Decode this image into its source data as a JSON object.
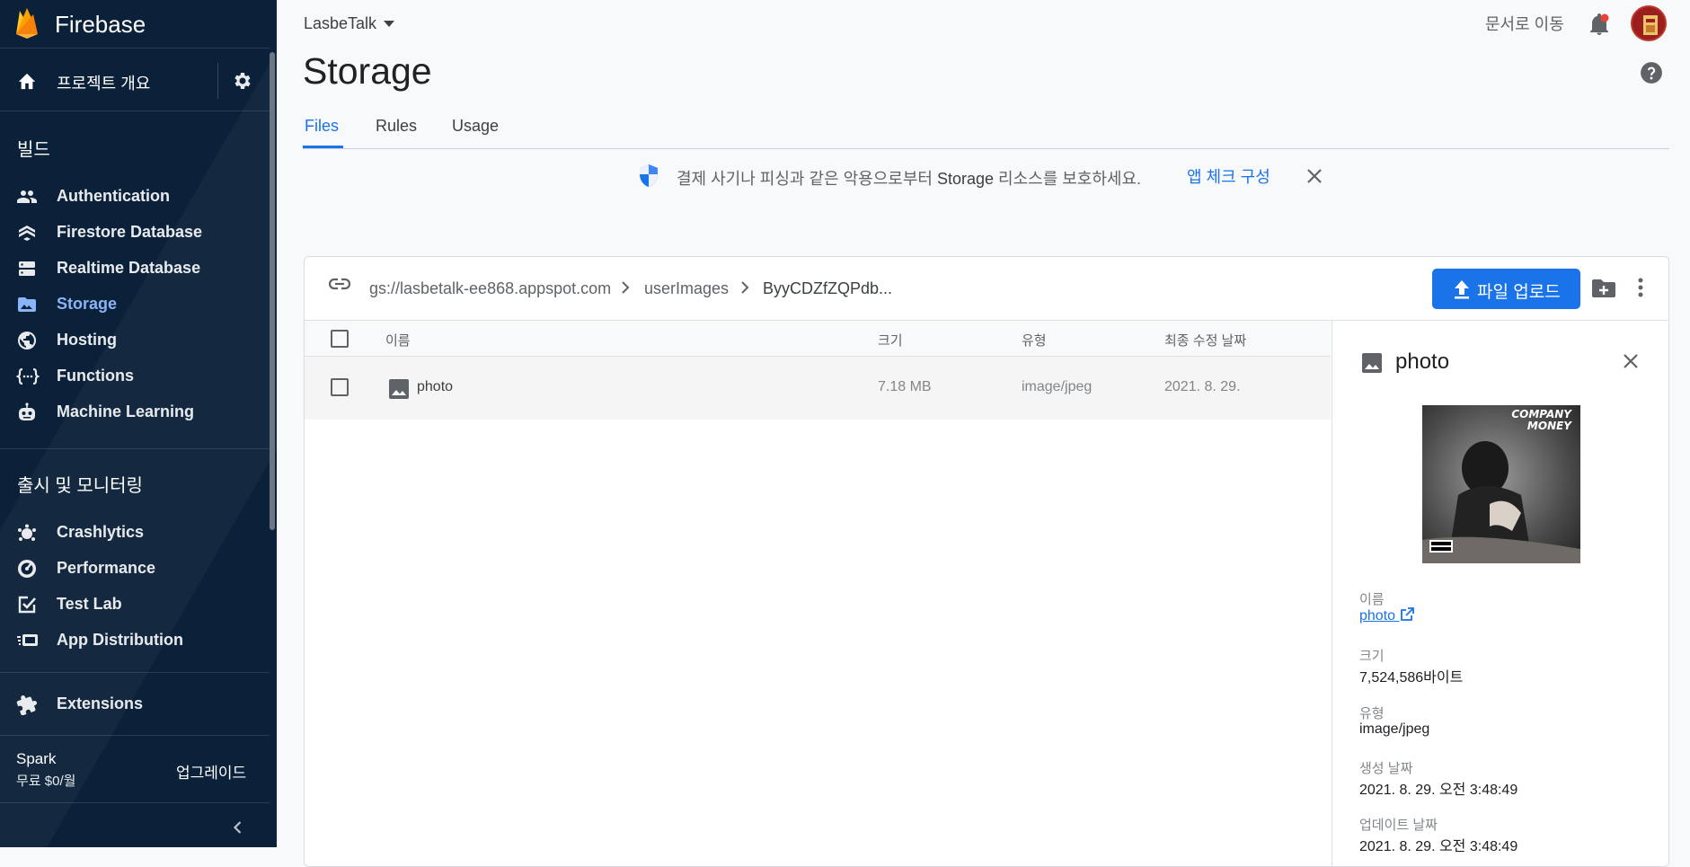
{
  "app": {
    "brand": "Firebase"
  },
  "sidebar": {
    "overview_label": "프로젝트 개요",
    "build_title": "빌드",
    "build_items": [
      {
        "label": "Authentication",
        "icon": "people-icon"
      },
      {
        "label": "Firestore Database",
        "icon": "firestore-icon"
      },
      {
        "label": "Realtime Database",
        "icon": "database-icon"
      },
      {
        "label": "Storage",
        "icon": "storage-folder-icon"
      },
      {
        "label": "Hosting",
        "icon": "globe-icon"
      },
      {
        "label": "Functions",
        "icon": "functions-icon"
      },
      {
        "label": "Machine Learning",
        "icon": "robot-icon"
      }
    ],
    "release_title": "출시 및 모니터링",
    "release_items": [
      {
        "label": "Crashlytics",
        "icon": "crashlytics-icon"
      },
      {
        "label": "Performance",
        "icon": "speedometer-icon"
      },
      {
        "label": "Test Lab",
        "icon": "checklist-icon"
      },
      {
        "label": "App Distribution",
        "icon": "distribution-icon"
      }
    ],
    "extensions_label": "Extensions",
    "plan_name": "Spark",
    "plan_price": "무료 $0/월",
    "upgrade_label": "업그레이드",
    "active_item": "Storage"
  },
  "topbar": {
    "project": "LasbeTalk",
    "docs_link": "문서로 이동"
  },
  "page": {
    "title": "Storage",
    "tabs": [
      "Files",
      "Rules",
      "Usage"
    ],
    "active_tab": "Files"
  },
  "banner": {
    "text_before": "결제 사기나 피싱과 같은 악용으로부터 ",
    "text_bold": "Storage",
    "text_after": " 리소스를 보호하세요.",
    "action": "앱 체크 구성"
  },
  "browser": {
    "breadcrumb": [
      "gs://lasbetalk-ee868.appspot.com",
      "userImages",
      "ByyCDZfZQPdb..."
    ],
    "upload_label": "파일 업로드",
    "columns": [
      "이름",
      "크기",
      "유형",
      "최종 수정 날짜"
    ],
    "rows": [
      {
        "name": "photo",
        "size": "7.18 MB",
        "type": "image/jpeg",
        "modified": "2021. 8. 29."
      }
    ]
  },
  "detail": {
    "title": "photo",
    "preview_text": [
      "COMPANY",
      "MONEY"
    ],
    "fields": [
      {
        "label": "이름",
        "value": "photo"
      },
      {
        "label": "크기",
        "value": "7,524,586바이트"
      },
      {
        "label": "유형",
        "value": "image/jpeg"
      },
      {
        "label": "생성 날짜",
        "value": "2021. 8. 29. 오전 3:48:49"
      },
      {
        "label": "업데이트 날짜",
        "value": "2021. 8. 29. 오전 3:48:49"
      }
    ]
  },
  "colors": {
    "sidebar_bg": "#0b2139",
    "accent": "#1a73e8",
    "active_nav": "#8ab4f8"
  }
}
